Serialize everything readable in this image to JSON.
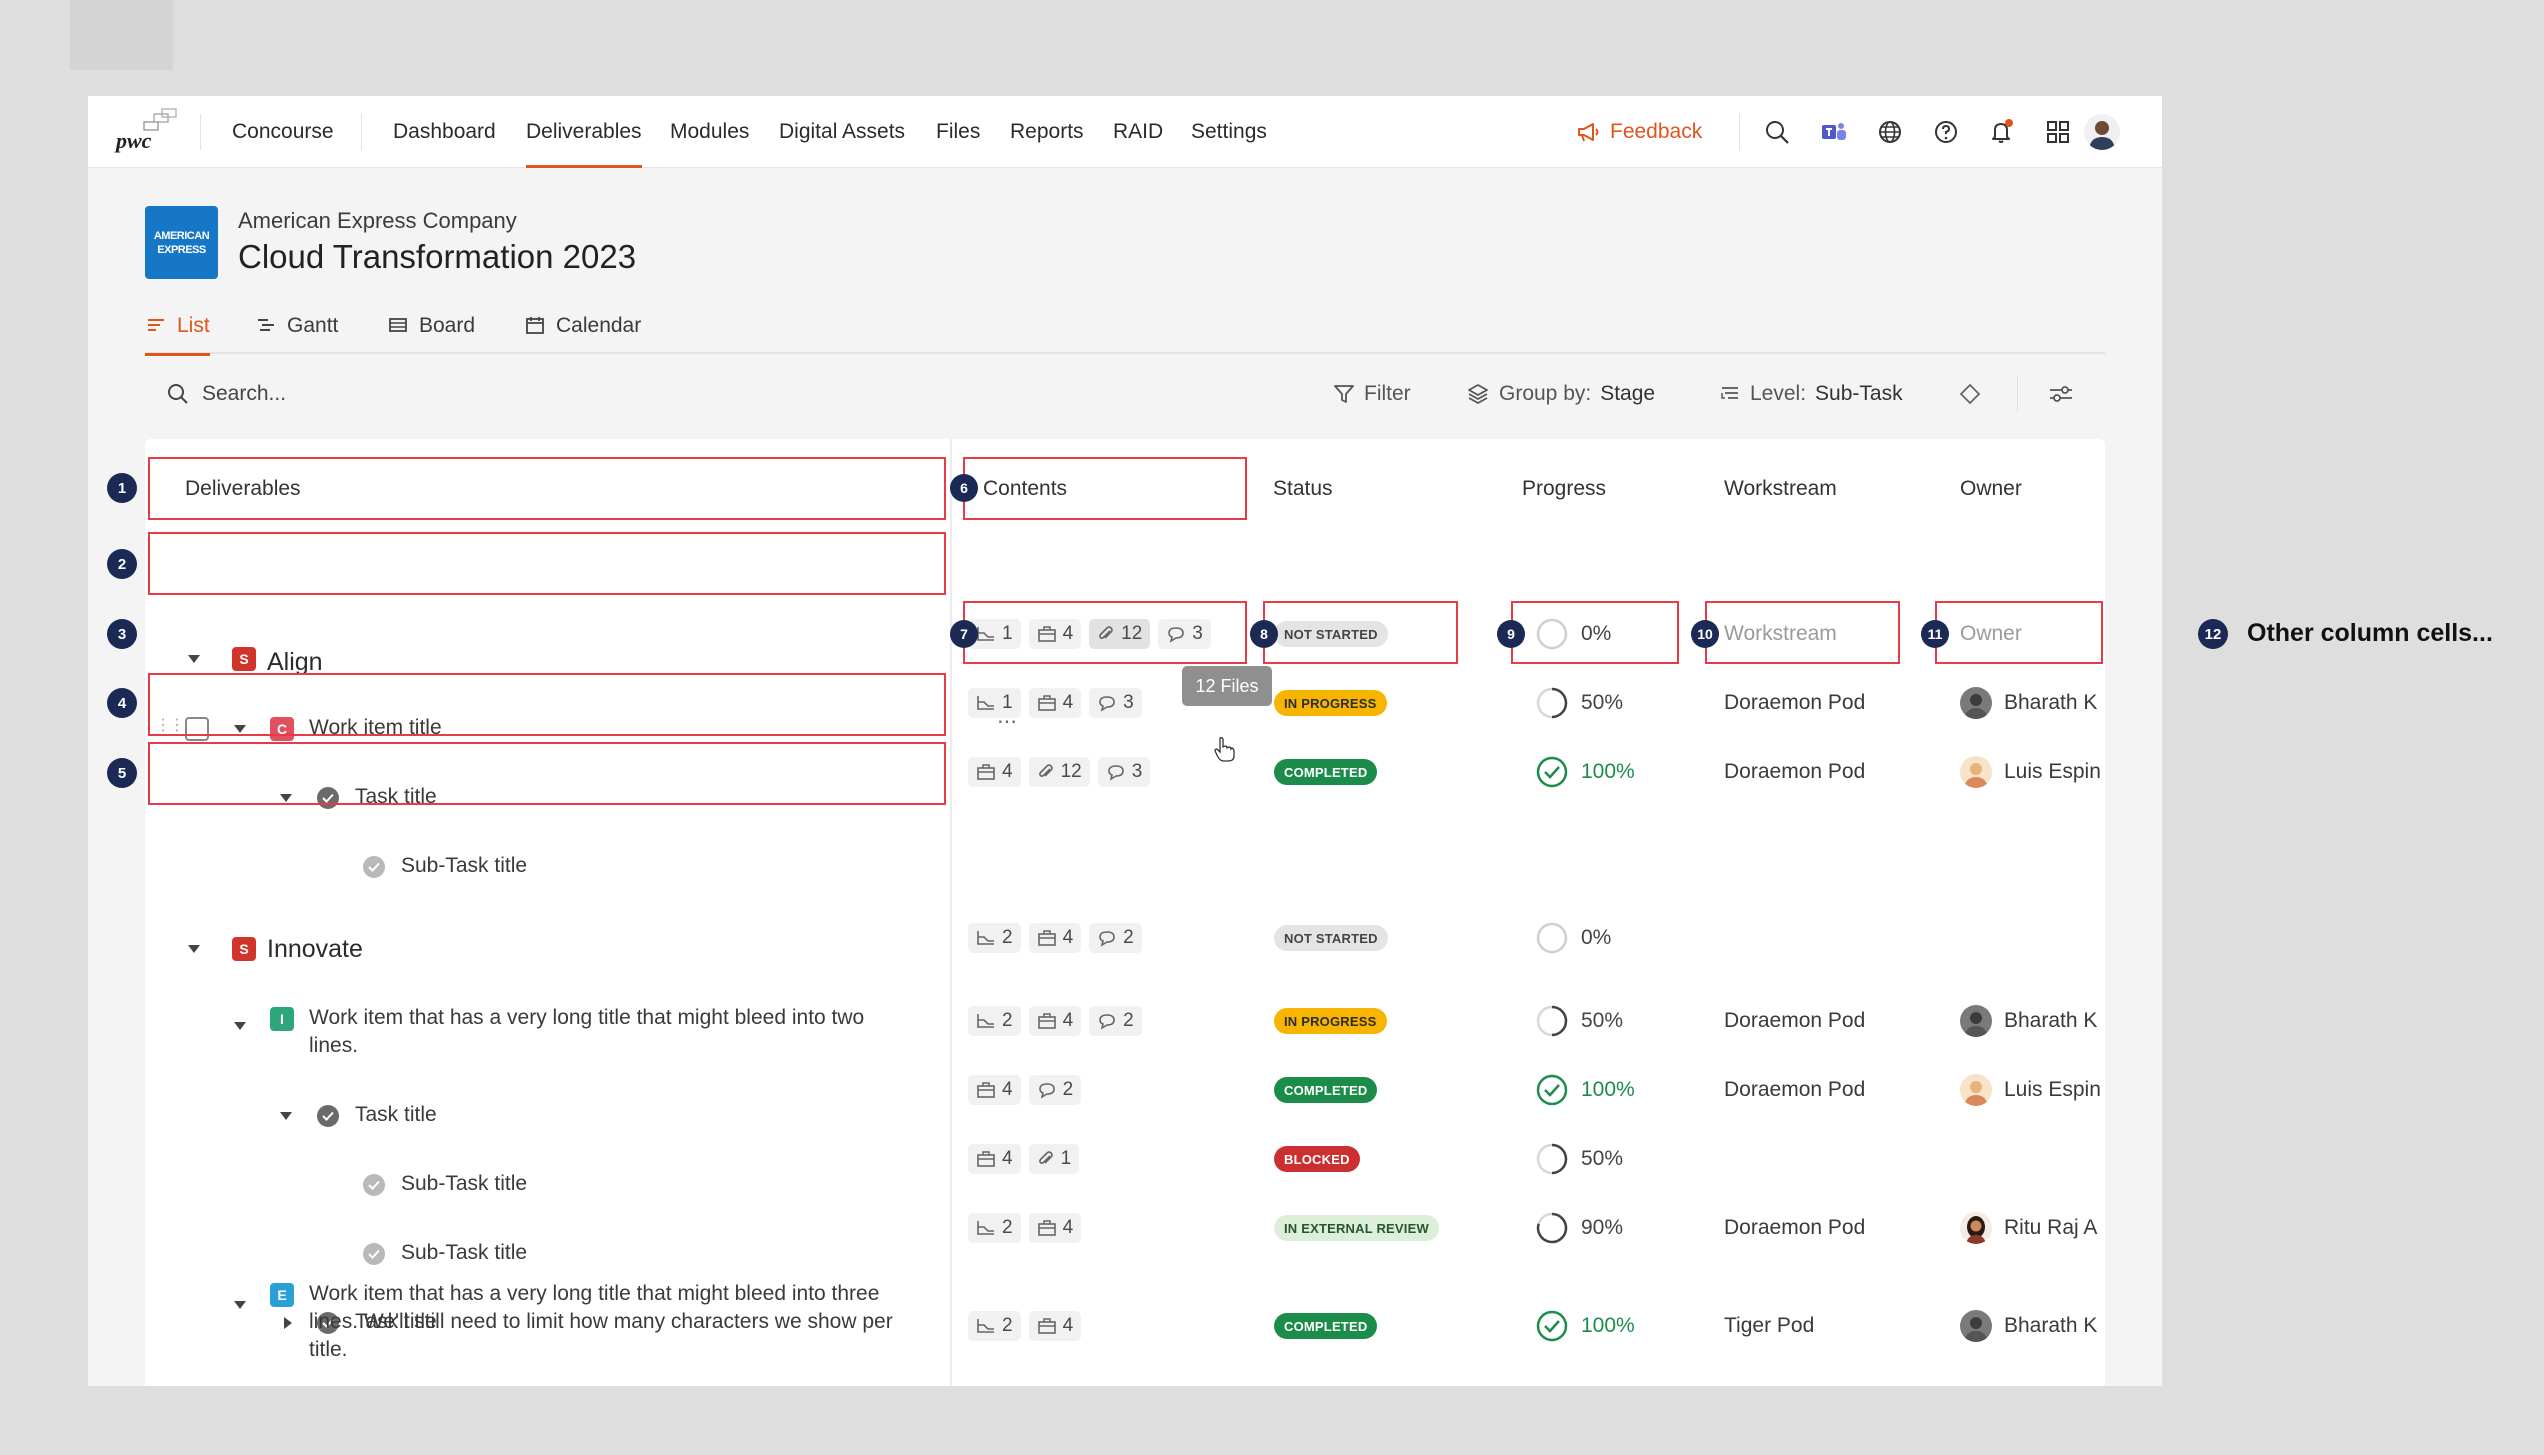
{
  "nav": {
    "product": "Concourse",
    "items": [
      "Dashboard",
      "Deliverables",
      "Modules",
      "Digital Assets",
      "Files",
      "Reports",
      "RAID",
      "Settings"
    ],
    "active": "Deliverables",
    "feedback": "Feedback",
    "logo_word": "pwc",
    "accent_color": "#e0551b"
  },
  "project": {
    "company": "American Express Company",
    "title": "Cloud Transformation 2023",
    "logo_lines": [
      "AMERICAN",
      "EXPRESS"
    ],
    "brand_color": "#1577c5"
  },
  "view_tabs": [
    "List",
    "Gantt",
    "Board",
    "Calendar"
  ],
  "toolbar": {
    "search_placeholder": "Search...",
    "filter": "Filter",
    "group_by_label": "Group by:",
    "group_by_value": "Stage",
    "level_label": "Level:",
    "level_value": "Sub-Task"
  },
  "columns": [
    "Deliverables",
    "Contents",
    "Status",
    "Progress",
    "Workstream",
    "Owner"
  ],
  "stages": [
    {
      "badge": "S",
      "name": "Align"
    },
    {
      "badge": "S",
      "name": "Innovate"
    }
  ],
  "rows": [
    {
      "title": "Work item title",
      "badge": "C",
      "contents": {
        "stages": "1",
        "boxes": "4",
        "files": "12",
        "comments": "3"
      },
      "status": "NOT STARTED",
      "progress": "0%",
      "workstream": "Workstream",
      "owner": "Owner"
    },
    {
      "title": "Task title",
      "contents": {
        "stages": "1",
        "boxes": "4",
        "comments": "3"
      },
      "status": "IN PROGRESS",
      "progress": "50%",
      "workstream": "Doraemon Pod",
      "owner": "Bharath K"
    },
    {
      "title": "Sub-Task title",
      "contents": {
        "boxes": "4",
        "files": "12",
        "comments": "3"
      },
      "status": "COMPLETED",
      "progress": "100%",
      "workstream": "Doraemon Pod",
      "owner": "Luis Espin"
    },
    {
      "title_line1": "Work item that has a very long title that might bleed into two",
      "title_line2": "lines.",
      "badge": "I",
      "contents": {
        "stages": "2",
        "boxes": "4",
        "comments": "2"
      },
      "status": "NOT STARTED",
      "progress": "0%"
    },
    {
      "title": "Task title",
      "contents": {
        "stages": "2",
        "boxes": "4",
        "comments": "2"
      },
      "status": "IN PROGRESS",
      "progress": "50%",
      "workstream": "Doraemon Pod",
      "owner": "Bharath K"
    },
    {
      "title": "Sub-Task title",
      "contents": {
        "boxes": "4",
        "comments": "2"
      },
      "status": "COMPLETED",
      "progress": "100%",
      "workstream": "Doraemon Pod",
      "owner": "Luis Espin"
    },
    {
      "title": "Sub-Task title",
      "contents": {
        "boxes": "4",
        "files": "1"
      },
      "status": "BLOCKED",
      "progress": "50%"
    },
    {
      "title": "Task title",
      "contents": {
        "stages": "2",
        "boxes": "4"
      },
      "status": "IN EXTERNAL REVIEW",
      "progress": "90%",
      "workstream": "Doraemon Pod",
      "owner": "Ritu Raj A"
    },
    {
      "title_line1": "Work item that has a very long title that might bleed into three",
      "title_line2": "lines. We'll still need to limit how many characters we show per",
      "title_line3": "title.",
      "badge": "E",
      "contents": {
        "stages": "2",
        "boxes": "4"
      },
      "status": "COMPLETED",
      "progress": "100%",
      "workstream": "Tiger Pod",
      "owner": "Bharath K"
    }
  ],
  "tooltip": "12 Files",
  "annotations": {
    "markers": [
      "1",
      "2",
      "3",
      "4",
      "5",
      "6",
      "7",
      "8",
      "9",
      "10",
      "11",
      "12"
    ],
    "note": "Other column cells..."
  },
  "status_colors": {
    "not_started": "#e4e4e4",
    "in_progress": "#f7b500",
    "completed": "#1c8c4a",
    "blocked": "#cc2f2f",
    "in_external_review": "#dcefd9"
  }
}
